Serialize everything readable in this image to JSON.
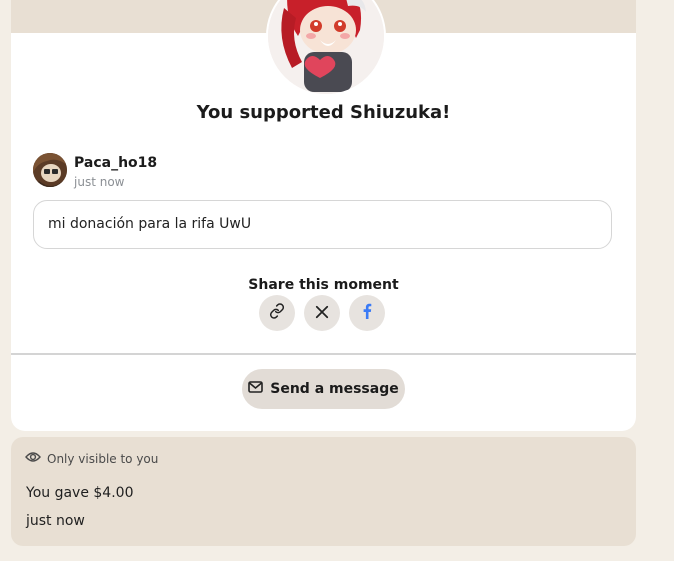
{
  "supported": {
    "title": "You supported Shiuzuka!"
  },
  "supporter": {
    "name": "Paca_ho18",
    "time": "just now",
    "message": "mi donación para la rifa UwU"
  },
  "share": {
    "label": "Share this moment",
    "buttons": [
      {
        "icon": "link-icon"
      },
      {
        "icon": "x-icon"
      },
      {
        "icon": "facebook-icon",
        "color": "#3b7bf6"
      }
    ]
  },
  "actions": {
    "send_message_label": "Send a message"
  },
  "private": {
    "visibility_label": "Only visible to you",
    "amount_line": "You gave $4.00",
    "time": "just now"
  },
  "colors": {
    "page_bg": "#f3eee6",
    "cover_bg": "#e8dfd3",
    "button_bg": "#e2dcd6",
    "share_btn_bg": "#e7e3df"
  }
}
